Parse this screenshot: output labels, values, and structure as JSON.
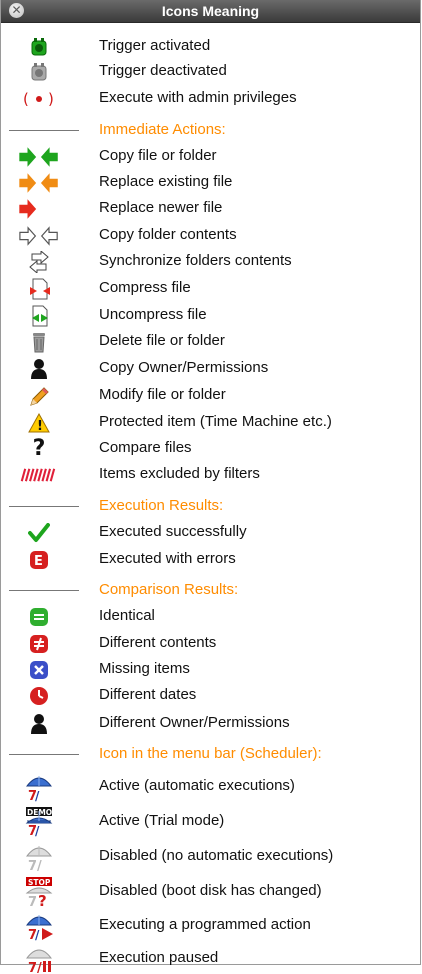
{
  "window": {
    "title": "Icons Meaning",
    "close_icon": "close-icon"
  },
  "colors": {
    "section_header": "#ff8c00",
    "title_bar": "#4a4a4a"
  },
  "rows": [
    {
      "label": "Trigger activated",
      "icon": "trigger-activated-icon"
    },
    {
      "label": "Trigger deactivated",
      "icon": "trigger-deactivated-icon"
    },
    {
      "label": "Execute with admin privileges",
      "icon": "admin-privileges-icon"
    },
    {
      "label": "Immediate Actions:",
      "section": true
    },
    {
      "label": "Copy file or folder",
      "icon": "copy-arrows-icon"
    },
    {
      "label": "Replace existing file",
      "icon": "replace-existing-arrows-icon"
    },
    {
      "label": "Replace newer file",
      "icon": "replace-newer-arrow-icon"
    },
    {
      "label": "Copy folder contents",
      "icon": "copy-contents-arrows-icon"
    },
    {
      "label": "Synchronize folders contents",
      "icon": "synchronize-arrows-icon"
    },
    {
      "label": "Compress file",
      "icon": "compress-file-icon"
    },
    {
      "label": "Uncompress file",
      "icon": "uncompress-file-icon"
    },
    {
      "label": "Delete file or folder",
      "icon": "trash-icon"
    },
    {
      "label": "Copy Owner/Permissions",
      "icon": "owner-person-icon"
    },
    {
      "label": "Modify file or folder",
      "icon": "pencil-icon"
    },
    {
      "label": "Protected item (Time Machine etc.)",
      "icon": "warning-icon"
    },
    {
      "label": "Compare files",
      "icon": "question-mark-icon"
    },
    {
      "label": "Items excluded by filters",
      "icon": "filter-stripes-icon"
    },
    {
      "label": "Execution Results:",
      "section": true
    },
    {
      "label": "Executed successfully",
      "icon": "checkmark-icon"
    },
    {
      "label": "Executed with errors",
      "icon": "error-e-icon"
    },
    {
      "label": "Comparison Results:",
      "section": true
    },
    {
      "label": "Identical",
      "icon": "identical-icon"
    },
    {
      "label": "Different contents",
      "icon": "different-contents-icon"
    },
    {
      "label": "Missing items",
      "icon": "missing-items-icon"
    },
    {
      "label": "Different dates",
      "icon": "clock-icon"
    },
    {
      "label": "Different Owner/Permissions",
      "icon": "owner-person-icon"
    },
    {
      "label": "Icon in the menu bar (Scheduler):",
      "section": true
    },
    {
      "label": "Active (automatic executions)",
      "icon": "umbrella-active-icon"
    },
    {
      "label": "Active (Trial mode)",
      "icon": "umbrella-demo-icon",
      "badge": "DEMO"
    },
    {
      "label": "Disabled (no automatic executions)",
      "icon": "umbrella-disabled-icon"
    },
    {
      "label": "Disabled (boot disk has changed)",
      "icon": "umbrella-stop-icon",
      "badge": "STOP"
    },
    {
      "label": "Executing a programmed action",
      "icon": "umbrella-executing-icon"
    },
    {
      "label": "Execution paused",
      "icon": "umbrella-paused-icon"
    }
  ]
}
